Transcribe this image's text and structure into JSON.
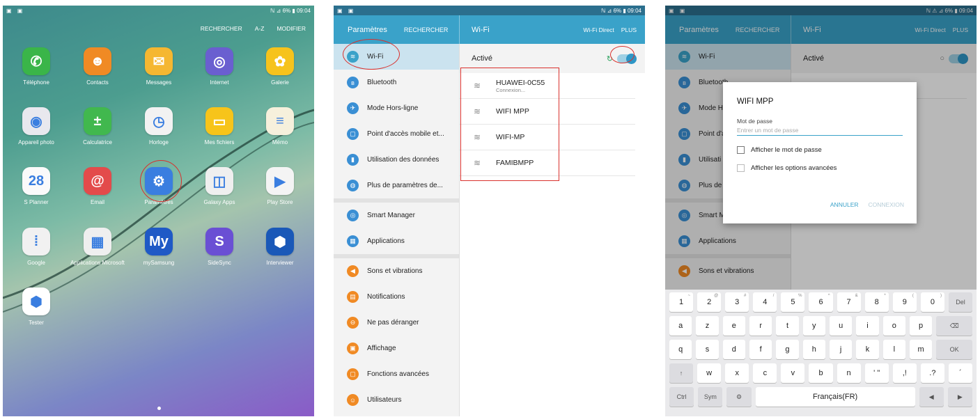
{
  "status": {
    "left_icons": "▣ ▣",
    "right": "ℕ ⊿ 6% ▮ 09:04",
    "right3": "ℕ ⚠ ⊿ 6% ▮ 09:04"
  },
  "home": {
    "top_actions": [
      "RECHERCHER",
      "A-Z",
      "MODIFIER"
    ],
    "apps": [
      {
        "label": "Téléphone",
        "color": "#3ab549",
        "glyph": "✆"
      },
      {
        "label": "Contacts",
        "color": "#f08a24",
        "glyph": "☻"
      },
      {
        "label": "Messages",
        "color": "#f5b731",
        "glyph": "✉"
      },
      {
        "label": "Internet",
        "color": "#6a5fd0",
        "glyph": "◎"
      },
      {
        "label": "Galerie",
        "color": "#f6c31c",
        "glyph": "✿"
      },
      {
        "label": "Appareil photo",
        "color": "#e8e8ee",
        "glyph": "◉"
      },
      {
        "label": "Calculatrice",
        "color": "#41b84e",
        "glyph": "±"
      },
      {
        "label": "Horloge",
        "color": "#f2f2f2",
        "glyph": "◷"
      },
      {
        "label": "Mes fichiers",
        "color": "#f7c41a",
        "glyph": "▭"
      },
      {
        "label": "Mémo",
        "color": "#f6f0dc",
        "glyph": "≡"
      },
      {
        "label": "S Planner",
        "color": "#fafafa",
        "glyph": "28"
      },
      {
        "label": "Email",
        "color": "#e34b4b",
        "glyph": "@"
      },
      {
        "label": "Paramètres",
        "color": "#3a7ee0",
        "glyph": "⚙"
      },
      {
        "label": "Galaxy Apps",
        "color": "#efefef",
        "glyph": "◫"
      },
      {
        "label": "Play Store",
        "color": "#f4f4f4",
        "glyph": "▶"
      },
      {
        "label": "Google",
        "color": "#f1f1f1",
        "glyph": "⁞"
      },
      {
        "label": "Applications Microsoft",
        "color": "#efefef",
        "glyph": "▦"
      },
      {
        "label": "mySamsung",
        "color": "#1f59c6",
        "glyph": "My"
      },
      {
        "label": "SideSync",
        "color": "#6a4fd4",
        "glyph": "S"
      },
      {
        "label": "Interviewer",
        "color": "#1a58b8",
        "glyph": "⬢"
      },
      {
        "label": "Tester",
        "color": "#ffffff",
        "glyph": "⬢"
      }
    ]
  },
  "settings": {
    "title": "Paramètres",
    "search": "RECHERCHER",
    "wifi_title": "Wi-Fi",
    "wifi_direct": "Wi-Fi Direct",
    "more": "PLUS",
    "active_label": "Activé",
    "menu": [
      {
        "label": "Wi-Fi",
        "color": "#3aa2c9",
        "glyph": "≋"
      },
      {
        "label": "Bluetooth",
        "color": "#3a8fd4",
        "glyph": "ʙ"
      },
      {
        "label": "Mode Hors-ligne",
        "color": "#3a8fd4",
        "glyph": "✈"
      },
      {
        "label": "Point d'accès mobile et...",
        "color": "#3a8fd4",
        "glyph": "▢"
      },
      {
        "label": "Utilisation des données",
        "color": "#3a8fd4",
        "glyph": "▮"
      },
      {
        "label": "Plus de paramètres de...",
        "color": "#3a8fd4",
        "glyph": "◍"
      },
      {
        "label": "Smart Manager",
        "color": "#3a8fd4",
        "glyph": "◎"
      },
      {
        "label": "Applications",
        "color": "#3a8fd4",
        "glyph": "▦"
      },
      {
        "label": "Sons et vibrations",
        "color": "#f08a24",
        "glyph": "◀"
      },
      {
        "label": "Notifications",
        "color": "#f08a24",
        "glyph": "▤"
      },
      {
        "label": "Ne pas déranger",
        "color": "#f08a24",
        "glyph": "⊖"
      },
      {
        "label": "Affichage",
        "color": "#f08a24",
        "glyph": "▣"
      },
      {
        "label": "Fonctions avancées",
        "color": "#f08a24",
        "glyph": "▢"
      },
      {
        "label": "Utilisateurs",
        "color": "#f08a24",
        "glyph": "☺"
      }
    ],
    "networks": [
      {
        "name": "HUAWEI-0C55",
        "sub": "Connexion..."
      },
      {
        "name": "WIFI MPP",
        "sub": ""
      },
      {
        "name": "WIFI-MP",
        "sub": ""
      },
      {
        "name": "FAMIBMPP",
        "sub": ""
      }
    ]
  },
  "dialog": {
    "title": "WIFI MPP",
    "password_label": "Mot de passe",
    "password_placeholder": "Entrer un mot de passe",
    "show_password": "Afficher le mot de passe",
    "show_advanced": "Afficher les options avancées",
    "cancel": "ANNULER",
    "connect": "CONNEXION"
  },
  "bg_menu3": [
    "Wi-Fi",
    "Bluetooth",
    "Mode H",
    "Point d'a",
    "Utilisati",
    "Plus de",
    "Smart M",
    "Applications",
    "Sons et vibrations"
  ],
  "keyboard": {
    "row1": [
      [
        "1",
        "~"
      ],
      [
        "2",
        "@"
      ],
      [
        "3",
        "#"
      ],
      [
        "4",
        "/"
      ],
      [
        "5",
        "%"
      ],
      [
        "6",
        "^"
      ],
      [
        "7",
        "&"
      ],
      [
        "8",
        "*"
      ],
      [
        "9",
        "("
      ],
      [
        "0",
        ")"
      ],
      [
        "Del",
        ""
      ]
    ],
    "row2": [
      "a",
      "z",
      "e",
      "r",
      "t",
      "y",
      "u",
      "i",
      "o",
      "p",
      "⌫"
    ],
    "row3": [
      "q",
      "s",
      "d",
      "f",
      "g",
      "h",
      "j",
      "k",
      "l",
      "m",
      "OK"
    ],
    "row4": [
      "↑",
      "w",
      "x",
      "c",
      "v",
      "b",
      "n",
      "' \"",
      ",!",
      ".?",
      "´"
    ],
    "row5": [
      "Ctrl",
      "Sym",
      "⚙",
      "Français(FR)",
      "◀",
      "▶"
    ]
  }
}
